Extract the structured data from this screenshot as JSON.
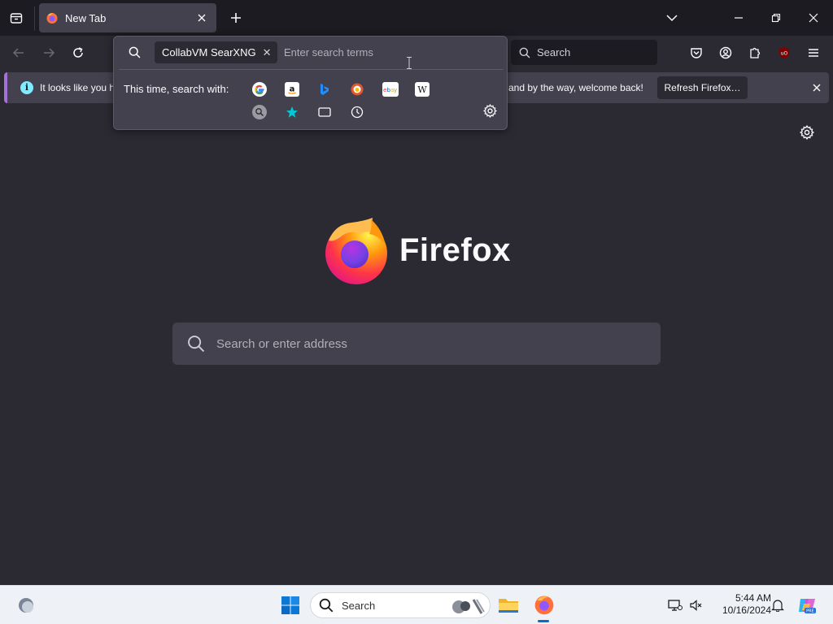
{
  "tab": {
    "title": "New Tab"
  },
  "toolbar": {
    "search_placeholder": "Search"
  },
  "notification": {
    "message_start": "It looks like you ha",
    "message_end": "and by the way, welcome back!",
    "button_label": "Refresh Firefox…"
  },
  "search_popup": {
    "engine_chip": "CollabVM SearXNG",
    "input_placeholder": "Enter search terms",
    "label": "This time, search with:",
    "engines": [
      "google",
      "amazon",
      "bing",
      "duckduckgo",
      "ebay",
      "wikipedia",
      "searxng",
      "bookmarks",
      "tabs",
      "history"
    ]
  },
  "content": {
    "brand": "Firefox",
    "search_placeholder": "Search or enter address"
  },
  "taskbar": {
    "search_label": "Search",
    "time": "5:44 AM",
    "date": "10/16/2024"
  },
  "colors": {
    "accent": "#a371d8",
    "background": "#2b2a33",
    "panel": "#42414d"
  }
}
